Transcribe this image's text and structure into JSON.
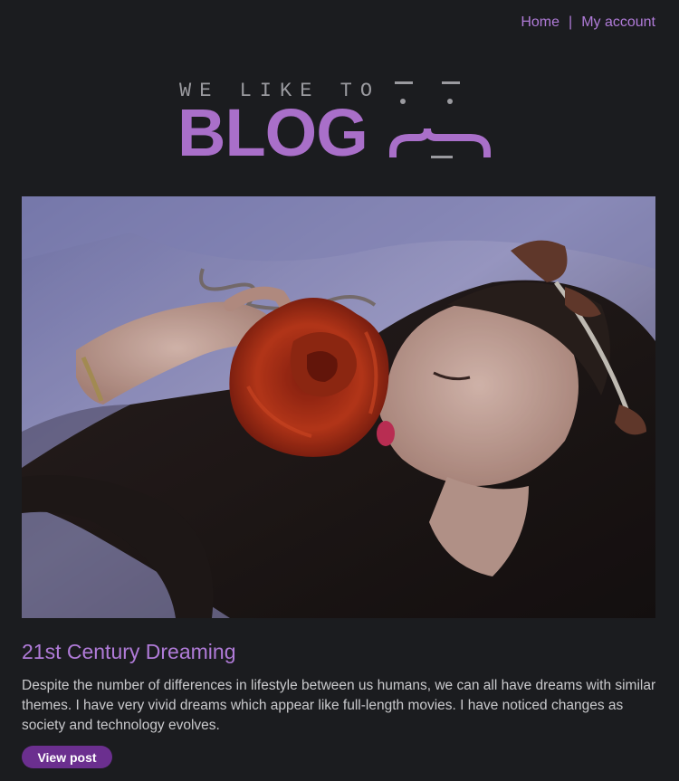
{
  "nav": {
    "home_label": "Home",
    "separator": "|",
    "account_label": "My account"
  },
  "logo": {
    "tagline": "WE LIKE TO",
    "wordmark": "BLOG"
  },
  "post": {
    "title": "21st Century Dreaming",
    "excerpt": "Despite the number of differences in lifestyle between us humans, we can all have dreams with similar themes. I have very vivid dreams which appear like full-length movies. I have noticed changes as society and technology evolves.",
    "button_label": "View post"
  },
  "colors": {
    "background": "#1b1c1f",
    "accent": "#b07bd8",
    "logo_purple": "#a96fc9",
    "button": "#6b2f8f",
    "body_text": "#c9c9cc"
  },
  "icons": {
    "logo_face": "sleepy-face-icon"
  }
}
